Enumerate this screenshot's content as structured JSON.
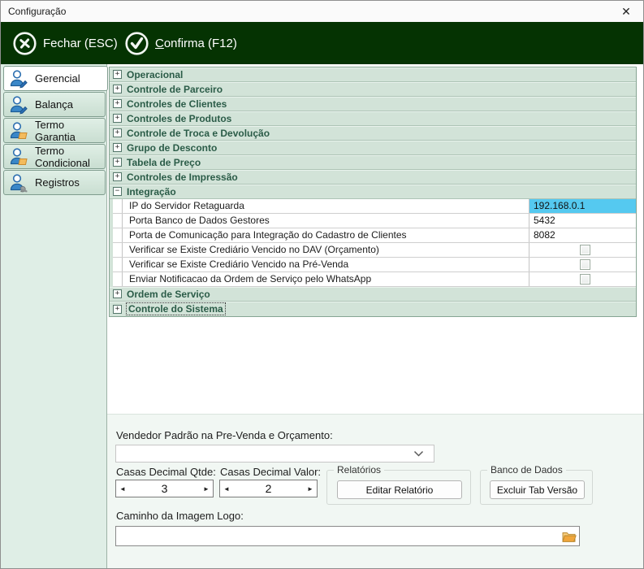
{
  "window": {
    "title": "Configuração",
    "close_glyph": "✕"
  },
  "toolbar": {
    "close_button": {
      "label": "Fechar (ESC)"
    },
    "confirm_button": {
      "label_underlined": "C",
      "label_rest": "onfirma (F12)"
    }
  },
  "sidebar": {
    "tabs": [
      {
        "label": "Gerencial",
        "icon": "user-edit-icon",
        "active": true
      },
      {
        "label": "Balança",
        "icon": "user-edit-icon",
        "active": false
      },
      {
        "label": "Termo Garantia",
        "icon": "user-document-icon",
        "active": false
      },
      {
        "label": "Termo Condicional",
        "icon": "user-document-icon",
        "active": false
      },
      {
        "label": "Registros",
        "icon": "user-wrench-icon",
        "active": false
      }
    ]
  },
  "accordion": {
    "sections": [
      {
        "label": "Operacional",
        "toggle": "+",
        "expanded": false
      },
      {
        "label": "Controle de Parceiro",
        "toggle": "+",
        "expanded": false
      },
      {
        "label": "Controles de Clientes",
        "toggle": "+",
        "expanded": false
      },
      {
        "label": "Controles de Produtos",
        "toggle": "+",
        "expanded": false
      },
      {
        "label": "Controle de Troca e Devolução",
        "toggle": "+",
        "expanded": false
      },
      {
        "label": "Grupo de Desconto",
        "toggle": "+",
        "expanded": false
      },
      {
        "label": "Tabela de Preço",
        "toggle": "+",
        "expanded": false
      },
      {
        "label": "Controles de Impressão",
        "toggle": "+",
        "expanded": false
      },
      {
        "label": "Integração",
        "toggle": "−",
        "expanded": true,
        "rows": [
          {
            "label": "IP do Servidor Retaguarda",
            "value": "192.168.0.1",
            "type": "text",
            "selected": true
          },
          {
            "label": "Porta Banco de Dados Gestores",
            "value": "5432",
            "type": "text",
            "selected": false
          },
          {
            "label": "Porta de Comunicação para Integração do Cadastro de Clientes",
            "value": "8082",
            "type": "text",
            "selected": false
          },
          {
            "label": "Verificar se Existe Crediário Vencido no DAV (Orçamento)",
            "type": "checkbox",
            "checked": false
          },
          {
            "label": "Verificar se Existe Crediário Vencido na Pré-Venda",
            "type": "checkbox",
            "checked": false
          },
          {
            "label": "Enviar Notificacao da Ordem de Serviço pelo WhatsApp",
            "type": "checkbox",
            "checked": false
          }
        ]
      },
      {
        "label": "Ordem de Serviço",
        "toggle": "+",
        "expanded": false
      },
      {
        "label": "Controle do Sistema",
        "toggle": "+",
        "expanded": false,
        "focused": true
      }
    ]
  },
  "form": {
    "vendor_label": "Vendedor Padrão na Pre-Venda e Orçamento:",
    "vendor_value": "",
    "decimal_qty_label": "Casas Decimal Qtde:",
    "decimal_qty_value": "3",
    "decimal_value_label": "Casas Decimal Valor:",
    "decimal_value_value": "2",
    "reports_group_label": "Relatórios",
    "edit_report_button": "Editar Relatório",
    "database_group_label": "Banco de Dados",
    "delete_tab_version_button": "Excluir Tab Versão",
    "logo_path_label": "Caminho da Imagem Logo:",
    "logo_path_value": ""
  },
  "icons": {
    "spinner_left": "◄",
    "spinner_right": "►"
  },
  "colors": {
    "toolbar_green": "#053302",
    "section_header_bg": "#d2e3d8",
    "section_header_text": "#2b5c48",
    "sidebar_bg": "#dfeee6",
    "selected_cell_bg": "#55c9f0",
    "bottom_panel_bg": "#f1f7f3"
  }
}
